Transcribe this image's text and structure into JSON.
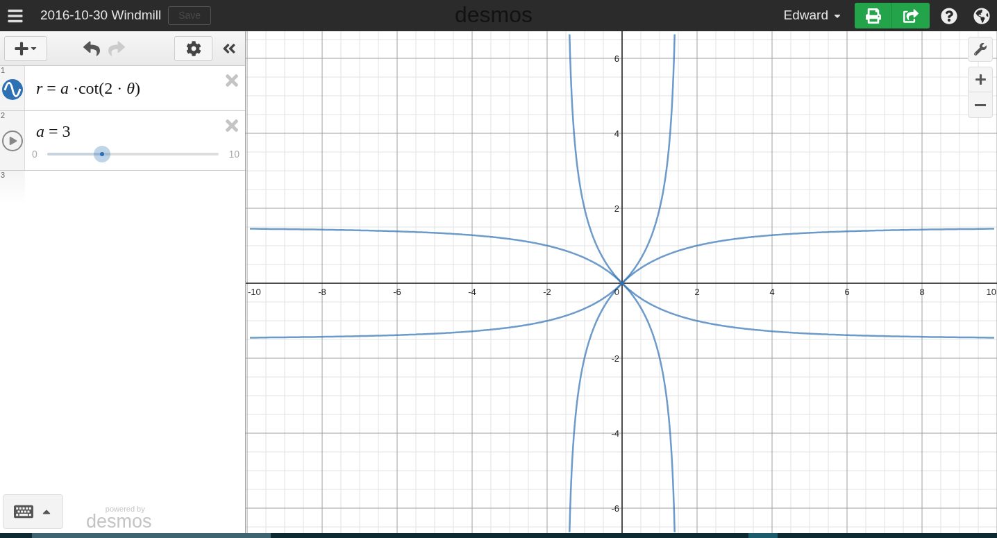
{
  "header": {
    "title": "2016-10-30 Windmill",
    "save_button": "Save",
    "logo": "desmos",
    "user": "Edward"
  },
  "expressions": [
    {
      "number": "1",
      "kind": "formula",
      "latex": "*r* = *a* ·cot(2 · *θ*)",
      "color": "#2d70b3"
    },
    {
      "number": "2",
      "kind": "slider",
      "latex": "*a* = 3",
      "min": "0",
      "max": "10",
      "level": 0.3
    },
    {
      "number": "3",
      "kind": "empty"
    }
  ],
  "graph": {
    "x_ticks": [
      "-10",
      "-8",
      "-6",
      "-4",
      "-2",
      "0",
      "2",
      "4",
      "6",
      "8",
      "10"
    ],
    "y_ticks": [
      "6",
      "4",
      "2",
      "-2",
      "-4",
      "-6"
    ]
  },
  "footer": {
    "powered_by": "powered by",
    "brand": "desmos"
  }
}
